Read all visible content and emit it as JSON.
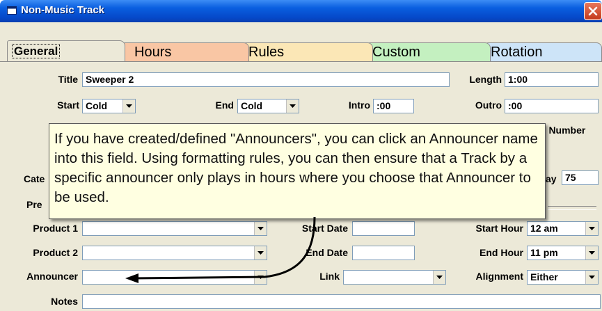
{
  "window": {
    "title": "Non-Music Track"
  },
  "tabs": [
    {
      "label": "General",
      "color": "#ece9d8",
      "active": true
    },
    {
      "label": "Hours",
      "color": "#f9c6a4"
    },
    {
      "label": "Rules",
      "color": "#fbe7b6"
    },
    {
      "label": "Custom",
      "color": "#c4f0c0"
    },
    {
      "label": "Rotation",
      "color": "#cde4f8"
    }
  ],
  "form": {
    "title": {
      "label": "Title",
      "value": "Sweeper 2"
    },
    "length": {
      "label": "Length",
      "value": "1:00"
    },
    "start": {
      "label": "Start",
      "value": "Cold"
    },
    "end": {
      "label": "End",
      "value": "Cold"
    },
    "intro": {
      "label": "Intro",
      "value": ":00"
    },
    "outro": {
      "label": "Outro",
      "value": ":00"
    },
    "number_partial": "o Number",
    "category_partial": "Cate",
    "pre_partial": "Pre",
    "day_partial": "ay",
    "day_value": "75",
    "product1": {
      "label": "Product 1",
      "value": ""
    },
    "product2": {
      "label": "Product 2",
      "value": ""
    },
    "announcer": {
      "label": "Announcer",
      "value": ""
    },
    "notes": {
      "label": "Notes",
      "value": ""
    },
    "start_date": {
      "label": "Start Date",
      "value": ""
    },
    "end_date": {
      "label": "End Date",
      "value": ""
    },
    "link": {
      "label": "Link",
      "value": ""
    },
    "start_hour": {
      "label": "Start Hour",
      "value": "12 am"
    },
    "end_hour": {
      "label": "End Hour",
      "value": "11 pm"
    },
    "alignment": {
      "label": "Alignment",
      "value": "Either"
    }
  },
  "tooltip": {
    "text": "If you have created/defined \"Announcers\", you can click an Announcer name into this field.  Using formatting rules, you can then ensure that a Track by a specific announcer only plays in hours where you choose that Announcer to be used."
  },
  "icons": {
    "app": "window-icon",
    "close": "close-icon",
    "arrow": "callout-arrow-icon"
  }
}
